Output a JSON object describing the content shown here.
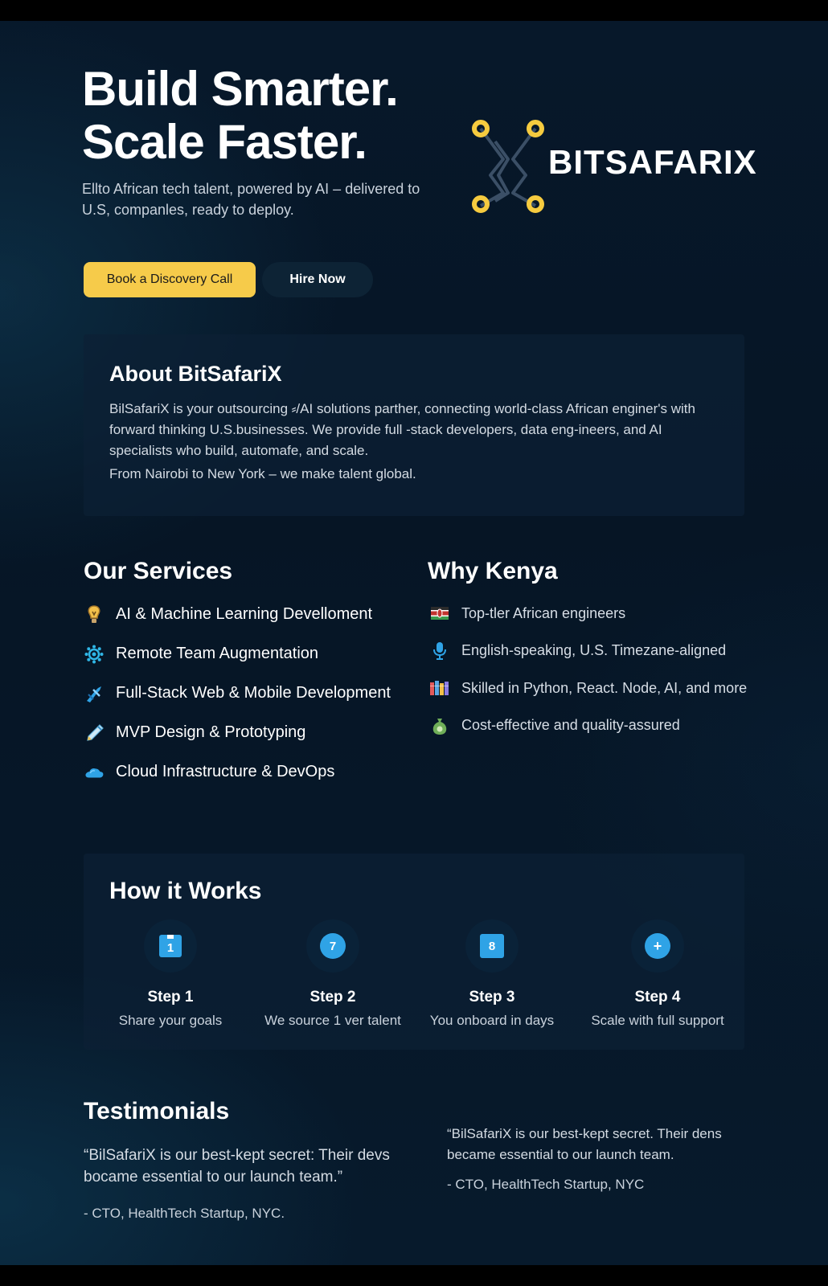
{
  "hero": {
    "title_line1": "Build Smarter.",
    "title_line2": "Scale Faster.",
    "subtitle": "Ellto African tech talent, powered by AI – delivered to U.S, companles, ready to deploy.",
    "primary_button": "Book a Discovery Call",
    "secondary_button": "Hire Now"
  },
  "logo": {
    "text": "BITSAFARIX",
    "accent_color": "#f6cb3f"
  },
  "about": {
    "title": "About BitSafariX",
    "body": "BilSafariX is your outsourcing ⸗/AI solutions parther, connecting world-class African enginer's with forward thinking U.S.businesses. We provide full -stack developers, data eng-ineers, and AI specialists who build, automafe, and scale.",
    "tagline": "From Nairobi to New York – we make talent global."
  },
  "services": {
    "title": "Our Services",
    "items": [
      {
        "label": "AI & Machine Learning Develloment",
        "icon": "bulb-icon"
      },
      {
        "label": "Remote Team Augmentation",
        "icon": "network-icon"
      },
      {
        "label": "Full-Stack Web & Mobile Development",
        "icon": "tool-icon"
      },
      {
        "label": "MVP Design & Prototyping",
        "icon": "pencil-icon"
      },
      {
        "label": "Cloud Infrastructure & DevOps",
        "icon": "cloud-icon"
      }
    ]
  },
  "why": {
    "title": "Why Kenya",
    "items": [
      {
        "label": "Top-tler African engineers",
        "icon": "flag-icon"
      },
      {
        "label": "English-speaking, U.S. Timezane-aligned",
        "icon": "microphone-icon"
      },
      {
        "label": "Skilled in Python, React. Node, AI, and more",
        "icon": "books-icon"
      },
      {
        "label": "Cost-effective and quality-assured",
        "icon": "money-bag-icon"
      }
    ]
  },
  "how": {
    "title": "How it Works",
    "steps": [
      {
        "label": "Step 1",
        "desc": "Share your goals",
        "badge": "1"
      },
      {
        "label": "Step 2",
        "desc": "We source 1 ver talent",
        "badge": "7"
      },
      {
        "label": "Step 3",
        "desc": "You onboard in days",
        "badge": "8"
      },
      {
        "label": "Step 4",
        "desc": "Scale with full support",
        "badge": "+"
      }
    ]
  },
  "testimonials": {
    "title": "Testimonials",
    "items": [
      {
        "quote": "“BilSafariX is our best-kept secret: Their devs bocame essential to our launch team.”",
        "author": "- CTO, HealthTech Startup, NYC."
      },
      {
        "quote": "“BilSafariX is our best-kept secret. Their dens became essential to our launch team.",
        "author": "- CTO, HealthTech Startup, NYC"
      }
    ]
  }
}
